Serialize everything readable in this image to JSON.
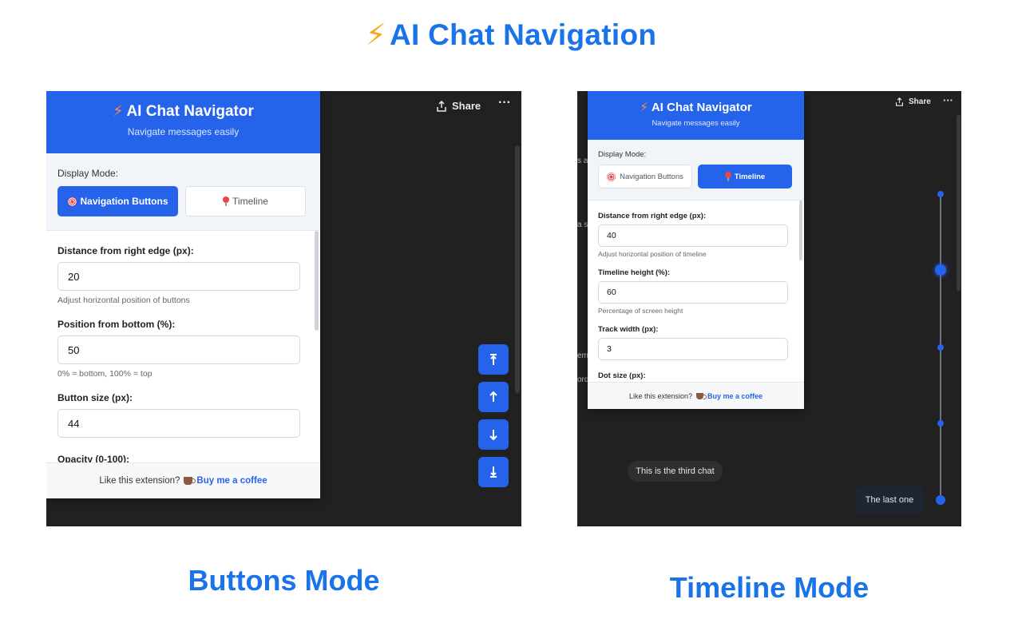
{
  "page": {
    "title_icon": "lightning-bolt-icon",
    "title": "AI Chat Navigation",
    "caption_left": "Buttons Mode",
    "caption_right": "Timeline Mode"
  },
  "topbar": {
    "share_label": "Share",
    "more_label": "···"
  },
  "panel": {
    "title": "AI Chat Navigator",
    "subtitle": "Navigate messages easily",
    "display_mode_label": "Display Mode:",
    "mode_buttons": {
      "nav": "Navigation Buttons",
      "timeline": "Timeline"
    },
    "footer_text": "Like this extension?",
    "footer_link": "Buy me a coffee"
  },
  "buttons_mode": {
    "active_mode": "nav",
    "fields": [
      {
        "label": "Distance from right edge (px):",
        "value": "20",
        "hint": "Adjust horizontal position of buttons"
      },
      {
        "label": "Position from bottom (%):",
        "value": "50",
        "hint": "0% = bottom, 100% = top"
      },
      {
        "label": "Button size (px):",
        "value": "44",
        "hint": ""
      },
      {
        "label": "Opacity (0-100):",
        "value": "",
        "hint": ""
      }
    ],
    "nav_buttons": [
      "jump-top-icon",
      "arrow-up-icon",
      "arrow-down-icon",
      "jump-bottom-icon"
    ]
  },
  "timeline_mode": {
    "active_mode": "timeline",
    "fields": [
      {
        "label": "Distance from right edge (px):",
        "value": "40",
        "hint": "Adjust horizontal position of timeline"
      },
      {
        "label": "Timeline height (%):",
        "value": "60",
        "hint": "Percentage of screen height"
      },
      {
        "label": "Track width (px):",
        "value": "3",
        "hint": ""
      },
      {
        "label": "Dot size (px):",
        "value": "",
        "hint": ""
      }
    ],
    "chat_messages": [
      "This is the third chat",
      "The last one"
    ],
    "text_fragments": [
      "s a",
      "a s",
      "em",
      "ord"
    ]
  },
  "colors": {
    "accent": "#2563eb",
    "title_blue": "#1a73e8",
    "bolt": "#f5a623",
    "dark_bg": "#212121"
  }
}
